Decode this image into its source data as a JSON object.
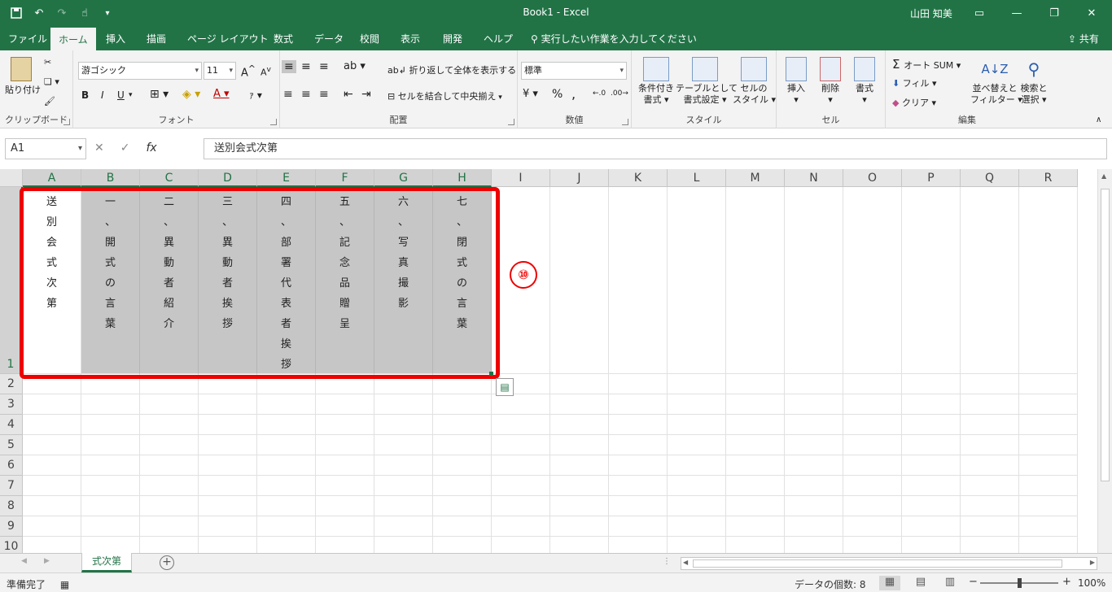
{
  "titlebar": {
    "doc_title": "Book1  -  Excel",
    "user_name": "山田 知美"
  },
  "tabs": [
    "ファイル",
    "ホーム",
    "挿入",
    "描画",
    "ページ レイアウト",
    "数式",
    "データ",
    "校閲",
    "表示",
    "開発",
    "ヘルプ"
  ],
  "active_tab": "ホーム",
  "tell_me": "実行したい作業を入力してください",
  "share": "共有",
  "ribbon": {
    "clipboard": {
      "label": "クリップボード",
      "paste": "貼り付け"
    },
    "font": {
      "label": "フォント",
      "font_name": "游ゴシック",
      "font_size": "11",
      "bold": "B",
      "italic": "I",
      "underline": "U"
    },
    "alignment": {
      "label": "配置",
      "wrap_text": "折り返して全体を表示する",
      "merge_center": "セルを結合して中央揃え"
    },
    "number": {
      "label": "数値",
      "format": "標準",
      "percent": "%",
      "comma": ","
    },
    "styles": {
      "label": "スタイル",
      "conditional": [
        "条件付き",
        "書式"
      ],
      "table": [
        "テーブルとして",
        "書式設定"
      ],
      "cell_styles": [
        "セルの",
        "スタイル"
      ]
    },
    "cells": {
      "label": "セル",
      "insert": "挿入",
      "delete": "削除",
      "format": "書式"
    },
    "editing": {
      "label": "編集",
      "autosum": "オート SUM",
      "fill": "フィル",
      "clear": "クリア",
      "sort": [
        "並べ替えと",
        "フィルター"
      ],
      "find": [
        "検索と",
        "選択"
      ]
    }
  },
  "formula_bar": {
    "name_box": "A1",
    "cancel": "✕",
    "enter": "✓",
    "fx": "fx",
    "content": "送別会式次第"
  },
  "columns": [
    "A",
    "B",
    "C",
    "D",
    "E",
    "F",
    "G",
    "H",
    "I",
    "J",
    "K",
    "L",
    "M",
    "N",
    "O",
    "P",
    "Q",
    "R"
  ],
  "rows": [
    "1",
    "2",
    "3",
    "4",
    "5",
    "6",
    "7",
    "8",
    "9",
    "10"
  ],
  "cells": [
    [
      "送",
      "別",
      "会",
      "式",
      "次",
      "第"
    ],
    [
      "一",
      "、",
      "開",
      "式",
      "の",
      "言",
      "葉"
    ],
    [
      "二",
      "、",
      "異",
      "動",
      "者",
      "紹",
      "介"
    ],
    [
      "三",
      "、",
      "異",
      "動",
      "者",
      "挨",
      "拶"
    ],
    [
      "四",
      "、",
      "部",
      "署",
      "代",
      "表",
      "者",
      "挨",
      "拶"
    ],
    [
      "五",
      "、",
      "記",
      "念",
      "品",
      "贈",
      "呈"
    ],
    [
      "六",
      "、",
      "写",
      "真",
      "撮",
      "影"
    ],
    [
      "七",
      "、",
      "閉",
      "式",
      "の",
      "言",
      "葉"
    ]
  ],
  "callout": "⑩",
  "sheet_tab": "式次第",
  "statusbar": {
    "ready": "準備完了",
    "count": "データの個数: 8",
    "zoom": "100%"
  },
  "colors": {
    "accent": "#217346",
    "highlight": "#ee0000",
    "selection": "#c6c6c6"
  }
}
